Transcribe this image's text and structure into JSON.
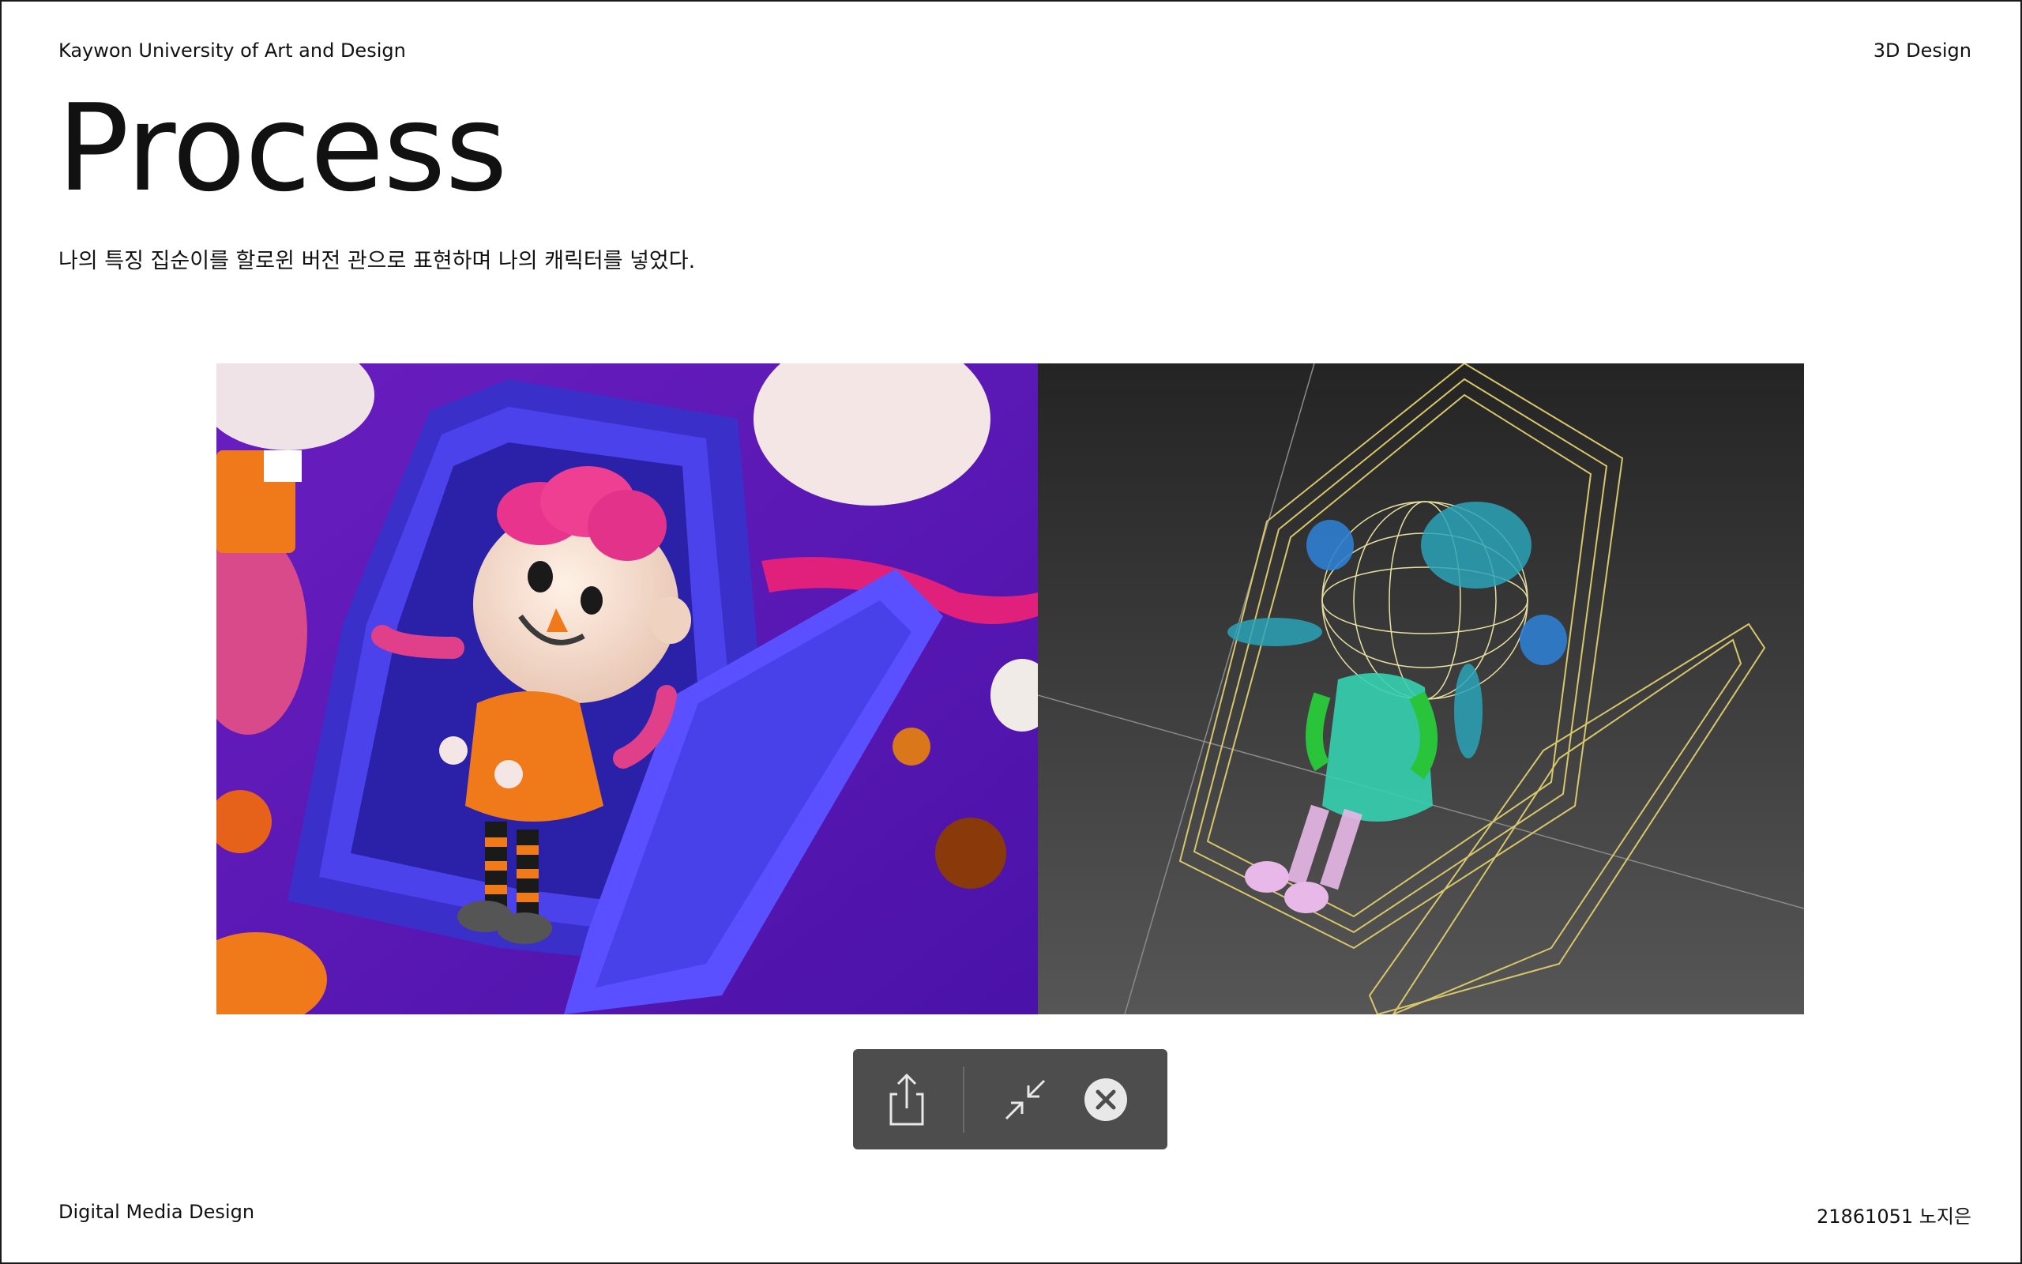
{
  "header": {
    "university": "Kaywon University of Art and Design",
    "course": "3D Design"
  },
  "title": "Process",
  "description": "나의 특징 집순이를 할로윈 버전 관으로 표현하며 나의 캐릭터를 넣었다.",
  "footer": {
    "department": "Digital Media Design",
    "student": "21861051 노지은"
  },
  "toolbar": {
    "buttons": [
      "share-icon",
      "shrink-icon",
      "close-icon"
    ]
  },
  "colors": {
    "render_background": "#5a17b5",
    "coffin": "#4a3fe8",
    "wireframe_background": "#3a3a3a",
    "toolbar_background": "#4d4d4d"
  }
}
